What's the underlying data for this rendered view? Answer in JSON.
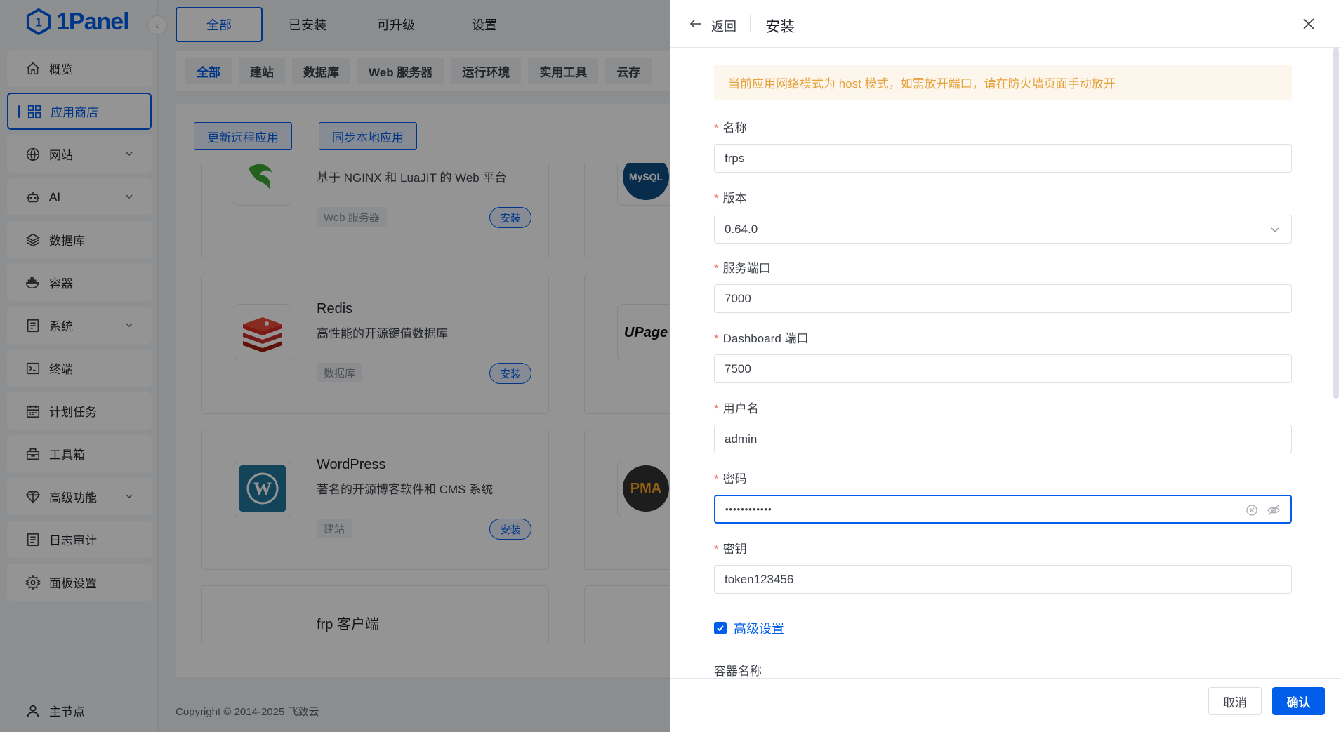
{
  "sidebar": {
    "logo_text": "1Panel",
    "items": [
      {
        "label": "概览",
        "icon": "home-icon"
      },
      {
        "label": "应用商店",
        "icon": "grid-icon",
        "active": true
      },
      {
        "label": "网站",
        "icon": "globe-icon",
        "expandable": true
      },
      {
        "label": "AI",
        "icon": "robot-icon",
        "expandable": true
      },
      {
        "label": "数据库",
        "icon": "database-layers-icon"
      },
      {
        "label": "容器",
        "icon": "docker-icon"
      },
      {
        "label": "系统",
        "icon": "server-icon",
        "expandable": true
      },
      {
        "label": "终端",
        "icon": "terminal-icon"
      },
      {
        "label": "计划任务",
        "icon": "calendar-icon"
      },
      {
        "label": "工具箱",
        "icon": "toolbox-icon"
      },
      {
        "label": "高级功能",
        "icon": "diamond-icon",
        "expandable": true
      },
      {
        "label": "日志审计",
        "icon": "log-icon"
      },
      {
        "label": "面板设置",
        "icon": "gear-icon"
      }
    ],
    "node_label": "主节点"
  },
  "main": {
    "tabs": [
      "全部",
      "已安装",
      "可升级",
      "设置"
    ],
    "filters": [
      "全部",
      "建站",
      "数据库",
      "Web 服务器",
      "运行环境",
      "实用工具",
      "云存"
    ],
    "sync_remote_label": "更新远程应用",
    "sync_local_label": "同步本地应用",
    "apps": [
      {
        "name": "",
        "desc": "基于 NGINX 和 LuaJIT 的 Web 平台",
        "tag": "Web 服务器",
        "install": "安装"
      },
      {
        "name": "Redis",
        "desc": "高性能的开源键值数据库",
        "tag": "数据库",
        "install": "安装"
      },
      {
        "name": "WordPress",
        "desc": "著名的开源博客软件和 CMS 系统",
        "tag": "建站",
        "install": "安装"
      },
      {
        "name": "frp 客户端",
        "desc": "",
        "tag": "",
        "install": ""
      }
    ],
    "side_logos": {
      "mysql": "MySQL",
      "upage": "UPage",
      "pma": "PMA"
    },
    "footer": "Copyright © 2014-2025 飞致云"
  },
  "drawer": {
    "back_label": "返回",
    "title": "安装",
    "alert": "当前应用网络模式为 host 模式，如需放开端口，请在防火墙页面手动放开",
    "fields": {
      "name": {
        "label": "名称",
        "value": "frps"
      },
      "version": {
        "label": "版本",
        "value": "0.64.0"
      },
      "service_port": {
        "label": "服务端口",
        "value": "7000"
      },
      "dashboard_port": {
        "label": "Dashboard 端口",
        "value": "7500"
      },
      "username": {
        "label": "用户名",
        "value": "admin"
      },
      "password": {
        "label": "密码",
        "value": "••••••••••••"
      },
      "token": {
        "label": "密钥",
        "value": "token123456"
      }
    },
    "advanced_label": "高级设置",
    "container_name_label": "容器名称",
    "cancel_label": "取消",
    "confirm_label": "确认"
  },
  "colors": {
    "accent": "#005eeb",
    "warning": "#e6a23c",
    "required": "#f56c6c"
  }
}
